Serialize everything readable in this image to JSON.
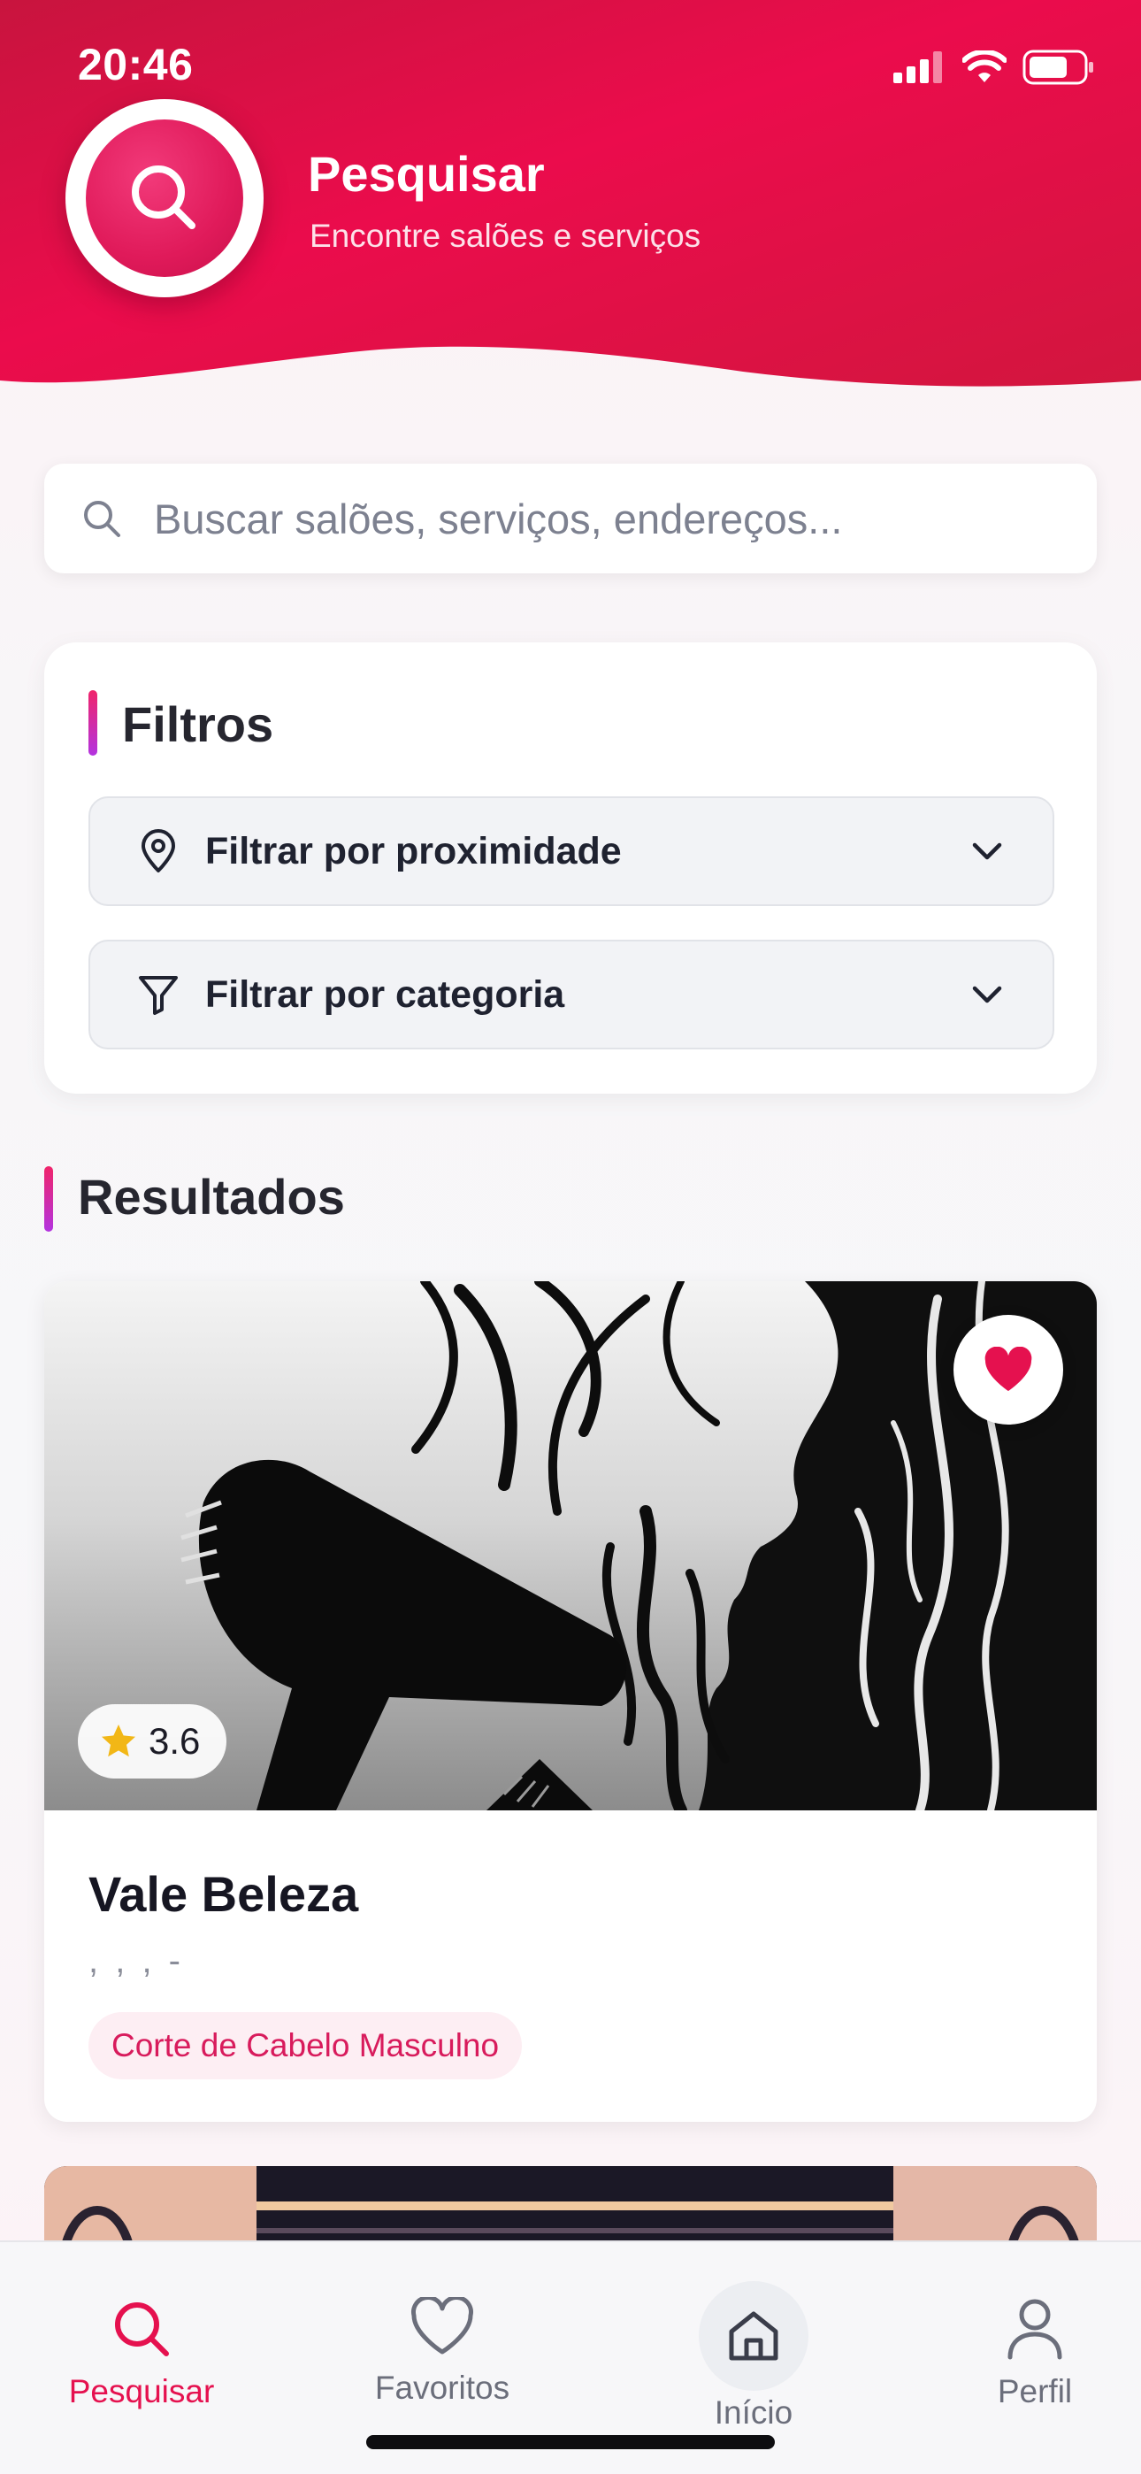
{
  "status_bar": {
    "time": "20:46"
  },
  "header": {
    "title": "Pesquisar",
    "subtitle": "Encontre salões e serviços",
    "icon": "search-icon"
  },
  "search": {
    "placeholder": "Buscar salões, serviços, endereços...",
    "value": ""
  },
  "filters": {
    "title": "Filtros",
    "items": [
      {
        "label": "Filtrar por proximidade",
        "icon": "location-pin-icon"
      },
      {
        "label": "Filtrar por categoria",
        "icon": "funnel-icon"
      }
    ]
  },
  "results": {
    "title": "Resultados",
    "items": [
      {
        "name": "Vale Beleza",
        "address": ", , , -",
        "rating": "3.6",
        "service": "Corte de Cabelo Masculno",
        "favorited": true
      }
    ]
  },
  "bottom_nav": {
    "items": [
      {
        "label": "Pesquisar",
        "icon": "search-icon",
        "active": true
      },
      {
        "label": "Favoritos",
        "icon": "heart-icon",
        "active": false
      },
      {
        "label": "Início",
        "icon": "home-icon",
        "active": false
      },
      {
        "label": "Perfil",
        "icon": "user-icon",
        "active": false
      }
    ]
  },
  "colors": {
    "brand": "#e5114f",
    "accent_pink": "#d81b5c",
    "accent_purple": "#b333e0",
    "rating_star": "#f2b716"
  }
}
